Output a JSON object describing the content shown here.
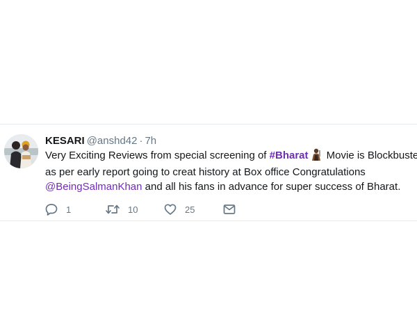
{
  "tweet": {
    "author_name": "KESARI",
    "author_handle": "@anshd42",
    "separator": "·",
    "timestamp": "7h",
    "text_before_hashtag": "Very Exciting Reviews from special screening of ",
    "hashtag": "#Bharat",
    "text_after_hashtag": " Movie is Blockbuster",
    "line2": "as per early report going to creat history at Box office Congratulations",
    "mention": "@BeingSalmanKhan",
    "line3_rest": " and all his fans in advance for super success of Bharat.",
    "emoji": "film-character-emoji",
    "replies": "1",
    "retweets": "10",
    "likes": "25"
  },
  "icons": {
    "reply": "reply-icon",
    "retweet": "retweet-icon",
    "like": "heart-icon",
    "dm": "envelope-icon"
  },
  "colors": {
    "link": "#6f2db5",
    "secondary_text": "#657786",
    "primary_text": "#14171a"
  }
}
